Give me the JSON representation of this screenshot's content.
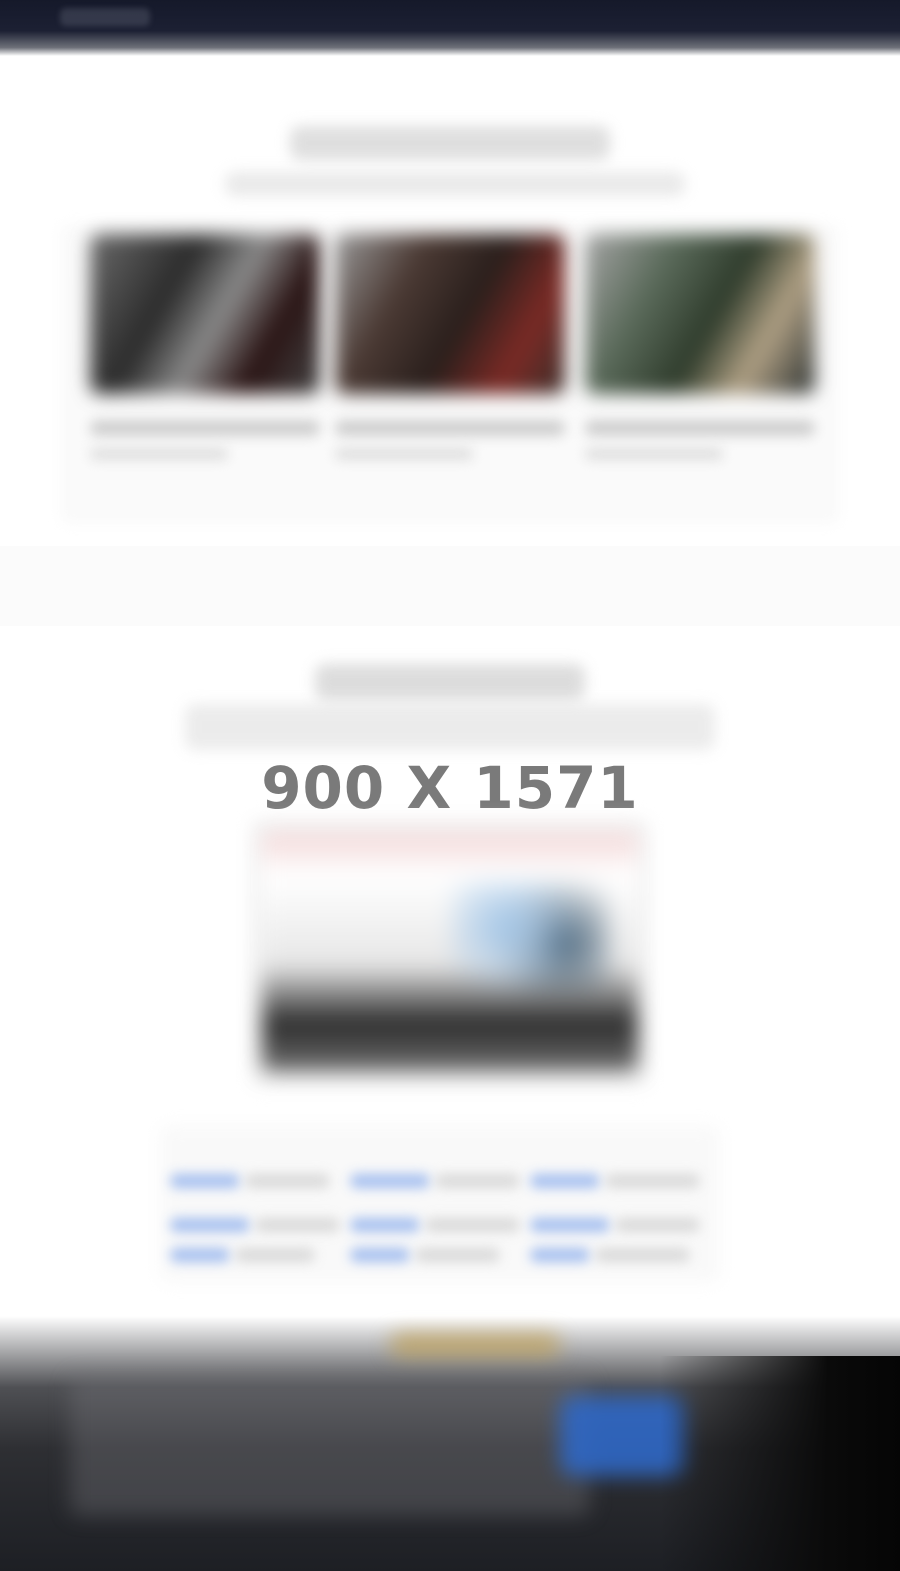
{
  "placeholder_label": "900 X 1571",
  "colors": {
    "header_dark": "#1c2033",
    "footer_dark": "#1d1f24",
    "placeholder_text": "#7a7a7a",
    "cta_blue": "#2f68c6",
    "accent_gold": "#c19d48"
  },
  "icons": []
}
